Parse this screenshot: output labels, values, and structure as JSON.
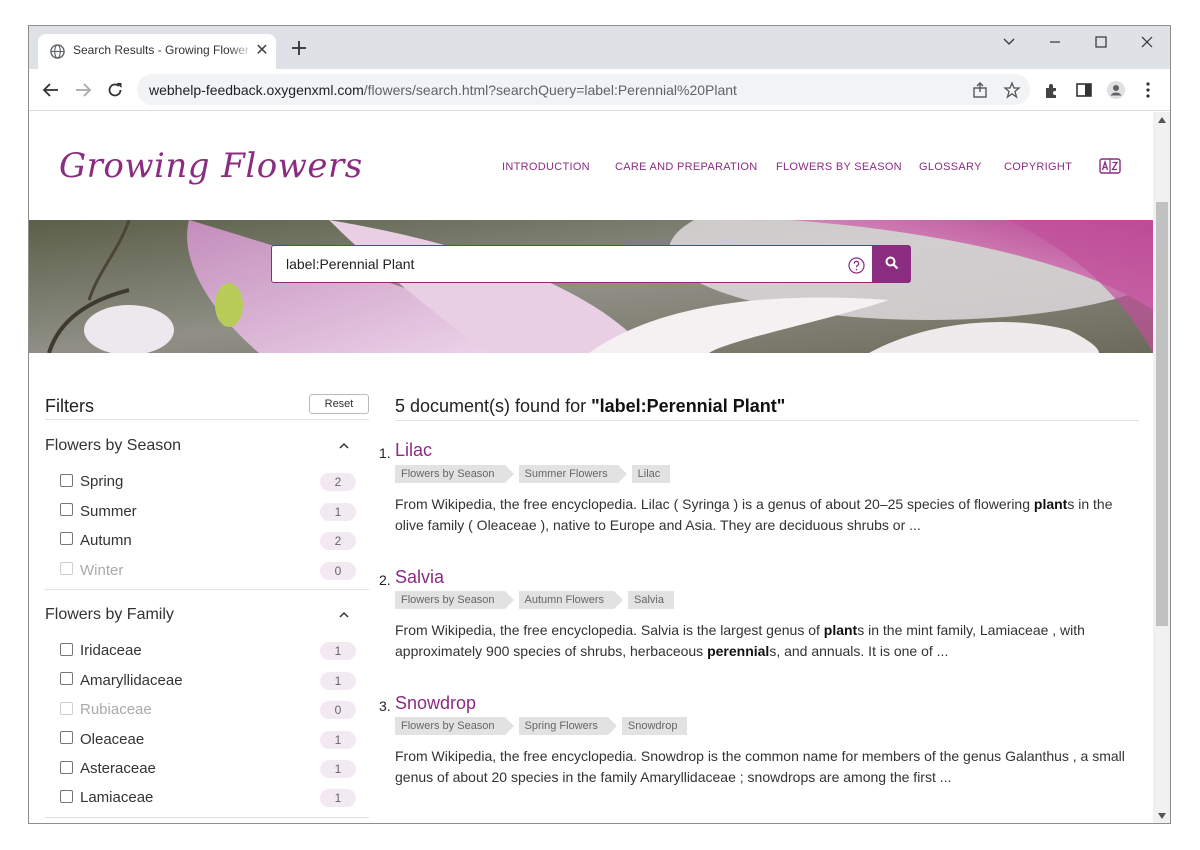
{
  "browser": {
    "tab_title": "Search Results - Growing Flower",
    "url_host": "webhelp-feedback.oxygenxml.com",
    "url_path": "/flowers/search.html?searchQuery=label:Perennial%20Plant"
  },
  "site": {
    "logo": "Growing Flowers",
    "nav": [
      "INTRODUCTION",
      "CARE AND PREPARATION",
      "FLOWERS BY SEASON",
      "GLOSSARY",
      "COPYRIGHT"
    ],
    "search_value": "label:Perennial Plant",
    "accent": "#8a2d81"
  },
  "filters": {
    "title": "Filters",
    "reset_label": "Reset",
    "groups": [
      {
        "title": "Flowers by Season",
        "options": [
          {
            "label": "Spring",
            "count": "2",
            "enabled": true
          },
          {
            "label": "Summer",
            "count": "1",
            "enabled": true
          },
          {
            "label": "Autumn",
            "count": "2",
            "enabled": true
          },
          {
            "label": "Winter",
            "count": "0",
            "enabled": false
          }
        ]
      },
      {
        "title": "Flowers by Family",
        "options": [
          {
            "label": "Iridaceae",
            "count": "1",
            "enabled": true
          },
          {
            "label": "Amaryllidaceae",
            "count": "1",
            "enabled": true
          },
          {
            "label": "Rubiaceae",
            "count": "0",
            "enabled": false
          },
          {
            "label": "Oleaceae",
            "count": "1",
            "enabled": true
          },
          {
            "label": "Asteraceae",
            "count": "1",
            "enabled": true
          },
          {
            "label": "Lamiaceae",
            "count": "1",
            "enabled": true
          }
        ]
      }
    ]
  },
  "results": {
    "heading_prefix": "5 document(s) found for ",
    "heading_query": "\"label:Perennial Plant\"",
    "items": [
      {
        "num": "1.",
        "title": "Lilac",
        "crumbs": [
          "Flowers by Season",
          "Summer Flowers",
          "Lilac"
        ],
        "desc_pre": "From Wikipedia, the free encyclopedia. Lilac ( Syringa ) is a genus of about 20–25 species of flowering ",
        "desc_bold": "plant",
        "desc_post": "s in the olive family ( Oleaceae ), native to Europe and Asia. They are deciduous shrubs or ..."
      },
      {
        "num": "2.",
        "title": "Salvia",
        "crumbs": [
          "Flowers by Season",
          "Autumn Flowers",
          "Salvia"
        ],
        "desc_pre": "From Wikipedia, the free encyclopedia. Salvia is the largest genus of ",
        "desc_bold": "plant",
        "desc_mid": "s in the mint family, Lamiaceae , with approximately 900 species of shrubs, herbaceous ",
        "desc_bold2": "perennial",
        "desc_post": "s, and annuals. It is one of ..."
      },
      {
        "num": "3.",
        "title": "Snowdrop",
        "crumbs": [
          "Flowers by Season",
          "Spring Flowers",
          "Snowdrop"
        ],
        "desc_pre": "From Wikipedia, the free encyclopedia. Snowdrop is the common name for members of the genus Galanthus , a small genus of about 20 species in the family Amaryllidaceae ; snowdrops are among the first ..."
      }
    ]
  }
}
